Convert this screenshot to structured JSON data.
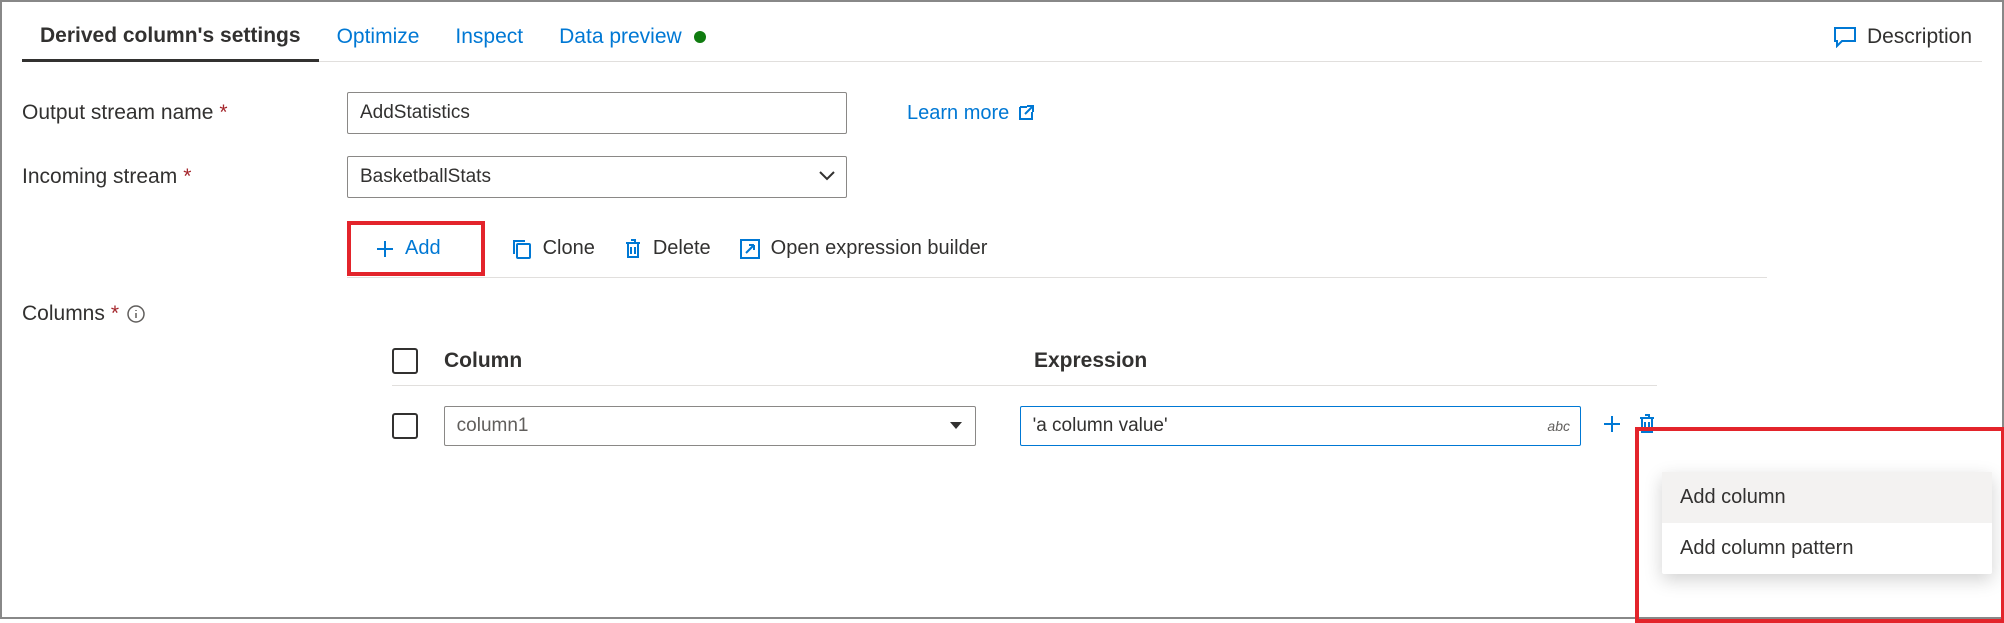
{
  "tabs": {
    "settings": "Derived column's settings",
    "optimize": "Optimize",
    "inspect": "Inspect",
    "preview": "Data preview"
  },
  "description_label": "Description",
  "form": {
    "output_stream_label": "Output stream name",
    "output_stream_value": "AddStatistics",
    "learn_more": "Learn more",
    "incoming_stream_label": "Incoming stream",
    "incoming_stream_value": "BasketballStats",
    "columns_label": "Columns"
  },
  "toolbar": {
    "add": "Add",
    "clone": "Clone",
    "delete": "Delete",
    "open_builder": "Open expression builder"
  },
  "grid": {
    "header_column": "Column",
    "header_expression": "Expression",
    "rows": [
      {
        "column_placeholder": "column1",
        "expression_value": "'a column value'",
        "type_hint": "abc"
      }
    ]
  },
  "context_menu": {
    "add_column": "Add column",
    "add_pattern": "Add column pattern"
  }
}
